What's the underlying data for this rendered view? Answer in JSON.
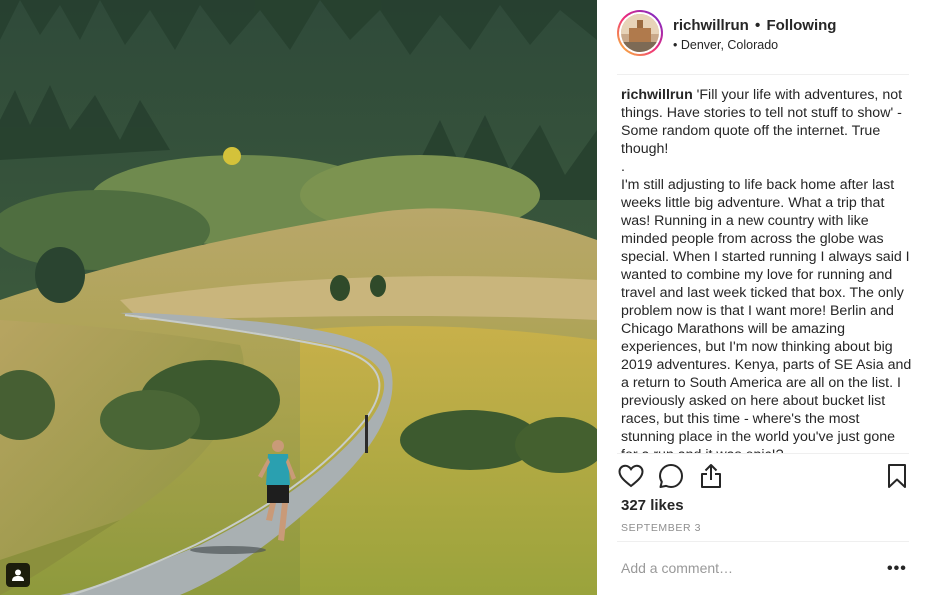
{
  "post": {
    "username": "richwillrun",
    "separator": "•",
    "follow_status": "Following",
    "location": "• Denver, Colorado"
  },
  "caption": {
    "username": "richwillrun",
    "line1": " 'Fill your life with adventures, not things. Have stories to tell not stuff to show' - Some random quote off the internet. True though!",
    "line2": ".",
    "line3": "I'm still adjusting to life back home after last weeks little big adventure. What a trip that was! Running in a new country with like minded people from across the globe was special. When I started running I always said I wanted to combine my love for running and travel and last week ticked that box. The only problem now is that I want more! Berlin and Chicago Marathons will be amazing experiences, but I'm now thinking about big 2019 adventures. Kenya, parts of SE Asia and a return to South America are all on the list. I previously asked on here about bucket list races, but this time - where's the most stunning place in the world you've just gone for a run and it was epic!?"
  },
  "actions": {
    "like_icon": "heart-icon",
    "comment_icon": "comment-bubble-icon",
    "share_icon": "share-upload-icon",
    "save_icon": "bookmark-icon"
  },
  "likes": "327 likes",
  "date": "SEPTEMBER 3",
  "comment_box": {
    "placeholder": "Add a comment…",
    "more": "•••"
  },
  "colors": {
    "text": "#262626",
    "muted": "#8e8e8e",
    "divider": "#efefef"
  }
}
